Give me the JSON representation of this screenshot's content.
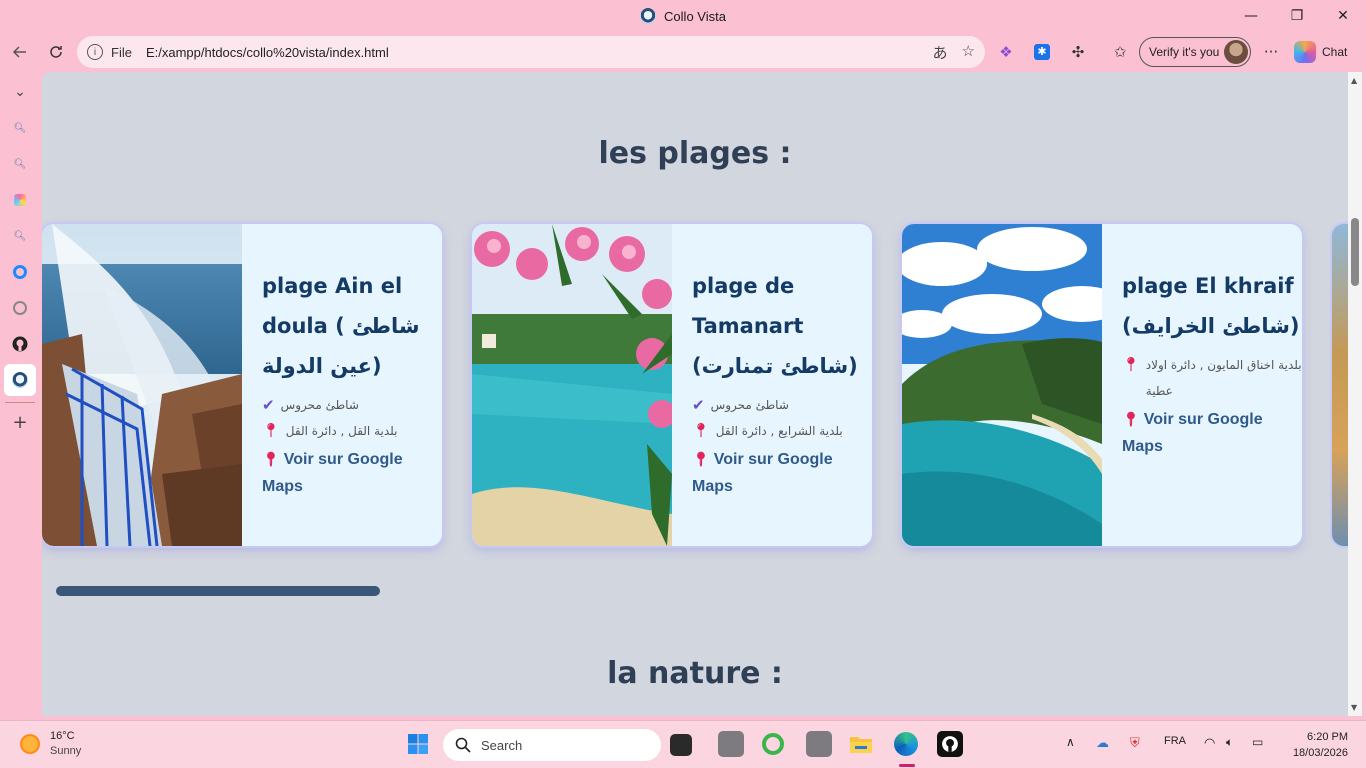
{
  "window": {
    "title": "Collo Vista",
    "controls": {
      "minimize": "—",
      "restore": "❐",
      "close": "✕"
    }
  },
  "toolbar": {
    "scheme_label": "File",
    "url": "E:/xampp/htdocs/collo%20vista/index.html",
    "verify_label": "Verify it's you",
    "chat_label": "Chat",
    "more_label": "···"
  },
  "page": {
    "section1_title": "les plages :",
    "section2_title": "la nature :",
    "cards": [
      {
        "name": "plage Ain el doula ( شاطئ عين الدولة)",
        "row1_icon": "check-icon",
        "row1": "شاطئ محروس",
        "row2": "بلدية القل , دائرة القل",
        "maps_label": "Voir sur Google Maps"
      },
      {
        "name": "plage de Tamanart (شاطئ تمنارت)",
        "row1_icon": "check-icon",
        "row1": "شاطئ محروس",
        "row2": "بلدية الشرايع , دائرة القل",
        "maps_label": "Voir sur Google Maps"
      },
      {
        "name": "plage El khraif (شاطئ الخرايف)",
        "row1_icon": "pin-icon",
        "row1": "بلدية اخناق المايون , دائرة اولاد عطية",
        "maps_label": "Voir sur Google Maps"
      }
    ]
  },
  "taskbar": {
    "weather_temp": "16°C",
    "weather_desc": "Sunny",
    "search_label": "Search",
    "lang": "FRA",
    "time": "6:20 PM",
    "date": "18/03/2026"
  },
  "colors": {
    "chrome_bg": "#fbc1d2",
    "content_bg": "#d2d6de",
    "card_bg": "#e6f5fe",
    "title_text": "#2f3f55",
    "card_title": "#143a66",
    "link": "#2f5a8a",
    "pin": "#e2245a",
    "check": "#6b4ec6"
  }
}
